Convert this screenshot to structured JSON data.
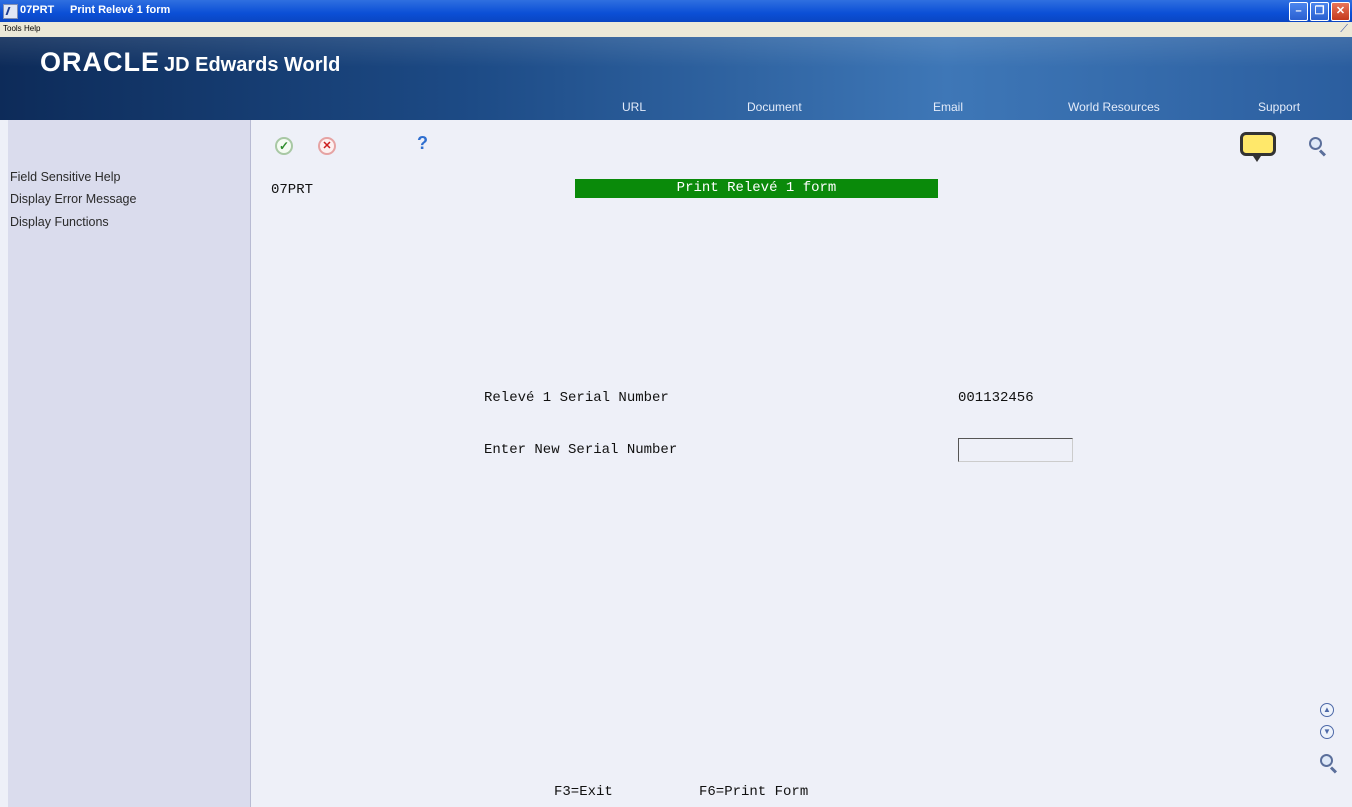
{
  "window": {
    "program": "07PRT",
    "title": "Print Relevé 1 form"
  },
  "menu": {
    "tools": "Tools",
    "help": "Help"
  },
  "banner": {
    "brand": "ORACLE",
    "product": "JD Edwards World",
    "links": [
      "URL",
      "Document",
      "Email",
      "World Resources",
      "Support"
    ]
  },
  "sidebar": {
    "items": [
      "Field Sensitive Help",
      "Display Error Message",
      "Display Functions"
    ]
  },
  "toolbar": {
    "help_glyph": "?"
  },
  "form": {
    "program_id": "07PRT",
    "title": "Print Relevé 1 form",
    "serial_label": "Relevé 1 Serial Number",
    "serial_value": "001132456",
    "new_serial_label": "Enter New Serial Number",
    "new_serial_value": ""
  },
  "footer": {
    "f3": "F3=Exit",
    "f6": "F6=Print Form"
  },
  "colors": {
    "title_bg": "#0a8a0a",
    "sidebar_bg": "#dadced",
    "main_bg": "#eef0f8"
  },
  "icons": [
    "check-icon",
    "cancel-icon",
    "help-icon",
    "speech-bubble-icon",
    "magnifier-icon",
    "scroll-up-icon",
    "scroll-down-icon"
  ]
}
